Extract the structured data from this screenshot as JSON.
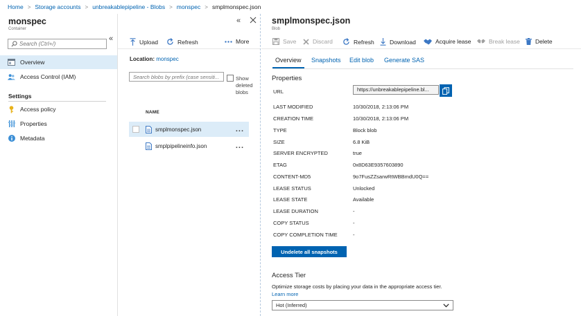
{
  "breadcrumb": {
    "items": [
      "Home",
      "Storage accounts",
      "unbreakablepipeline - Blobs",
      "monspec"
    ],
    "current": "smplmonspec.json"
  },
  "left": {
    "title": "monspec",
    "subtitle": "Container",
    "collapse_glyph": "«",
    "search_placeholder": "Search (Ctrl+/)",
    "nav": [
      {
        "label": "Overview",
        "icon": "overview-icon"
      },
      {
        "label": "Access Control (IAM)",
        "icon": "iam-users-icon"
      }
    ],
    "settings_heading": "Settings",
    "settings": [
      {
        "label": "Access policy",
        "icon": "key-icon"
      },
      {
        "label": "Properties",
        "icon": "properties-icon"
      },
      {
        "label": "Metadata",
        "icon": "info-icon"
      }
    ]
  },
  "middle": {
    "collapse_glyph": "«",
    "toolbar": {
      "upload": "Upload",
      "refresh": "Refresh",
      "more": "More"
    },
    "location_label": "Location:",
    "location_value": "monspec",
    "search_placeholder": "Search blobs by prefix (case sensiti...",
    "show_deleted": "Show deleted blobs",
    "column_name": "NAME",
    "blobs": [
      {
        "name": "smplmonspec.json",
        "selected": true
      },
      {
        "name": "smplpipelineinfo.json",
        "selected": false
      }
    ],
    "row_menu": "..."
  },
  "right": {
    "title": "smplmonspec.json",
    "subtitle": "Blob",
    "toolbar": {
      "save": "Save",
      "discard": "Discard",
      "refresh": "Refresh",
      "download": "Download",
      "acquire": "Acquire lease",
      "break": "Break lease",
      "delete": "Delete"
    },
    "tabs": [
      "Overview",
      "Snapshots",
      "Edit blob",
      "Generate SAS"
    ],
    "properties_heading": "Properties",
    "url_label": "URL",
    "url_value": "https://unbreakablepipeline.bl...",
    "properties": [
      {
        "key": "LAST MODIFIED",
        "value": "10/30/2018, 2:13:06 PM"
      },
      {
        "key": "CREATION TIME",
        "value": "10/30/2018, 2:13:06 PM"
      },
      {
        "key": "TYPE",
        "value": "Block blob"
      },
      {
        "key": "SIZE",
        "value": "6.8 KiB"
      },
      {
        "key": "SERVER ENCRYPTED",
        "value": "true"
      },
      {
        "key": "ETAG",
        "value": "0x8D63E9357603890"
      },
      {
        "key": "CONTENT-MD5",
        "value": "9o7FusZZsarwRtWBBmdU0Q=="
      },
      {
        "key": "LEASE STATUS",
        "value": "Unlocked"
      },
      {
        "key": "LEASE STATE",
        "value": "Available"
      },
      {
        "key": "LEASE DURATION",
        "value": "-"
      },
      {
        "key": "COPY STATUS",
        "value": "-"
      },
      {
        "key": "COPY COMPLETION TIME",
        "value": "-"
      }
    ],
    "undelete_button": "Undelete all snapshots",
    "access_tier_heading": "Access Tier",
    "access_tier_desc": "Optimize storage costs by placing your data in the appropriate access tier.",
    "learn_more": "Learn more",
    "access_tier_value": "Hot (Inferred)"
  },
  "colors": {
    "accent": "#0063b1",
    "selected_bg": "#dcecf8"
  }
}
